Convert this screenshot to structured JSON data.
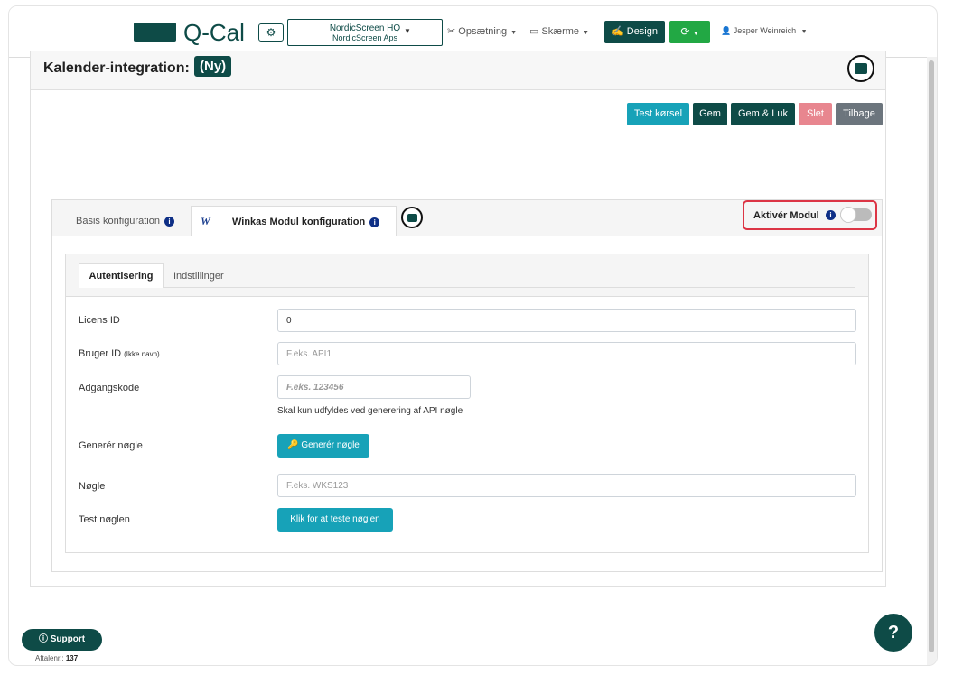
{
  "brand": {
    "name": "Q-Cal",
    "color": "#0e4b47"
  },
  "navbar": {
    "site_name": "NordicScreen HQ",
    "site_sub": "NordicScreen Aps",
    "setup_label": "Opsætning",
    "screens_label": "Skærme",
    "design_label": "Design",
    "user_name": "Jesper Weinreich"
  },
  "page": {
    "title": "Kalender-integration:",
    "badge": "(Ny)"
  },
  "actions": {
    "test_run": "Test kørsel",
    "save": "Gem",
    "save_close": "Gem & Luk",
    "delete": "Slet",
    "back": "Tilbage"
  },
  "tabs": {
    "basic": "Basis konfiguration",
    "winkas": "Winkas Modul konfiguration",
    "activate": "Aktivér Modul",
    "activate_enabled": false
  },
  "subtabs": {
    "auth": "Autentisering",
    "settings": "Indstillinger"
  },
  "form": {
    "license_label": "Licens ID",
    "license_value": "0",
    "user_label": "Bruger ID",
    "user_label_small": "(Ikke navn)",
    "user_placeholder": "F.eks. API1",
    "password_label": "Adgangskode",
    "password_placeholder": "F.eks. 123456",
    "password_help": "Skal kun udfyldes ved generering af API nøgle",
    "generate_label": "Generér nøgle",
    "generate_button": "Generér nøgle",
    "key_label": "Nøgle",
    "key_placeholder": "F.eks. WKS123",
    "test_label": "Test nøglen",
    "test_button": "Klik for at teste nøglen"
  },
  "footer": {
    "support": "Support",
    "agreement_label": "Aftalenr.:",
    "agreement_number": "137",
    "help": "?"
  },
  "colors": {
    "primary": "#0e4b47",
    "teal": "#17a2b8",
    "green": "#22a844",
    "danger": "#dc3545",
    "danger_light": "#e8868f",
    "secondary": "#6c757d",
    "info_icon": "#0e2f86"
  }
}
